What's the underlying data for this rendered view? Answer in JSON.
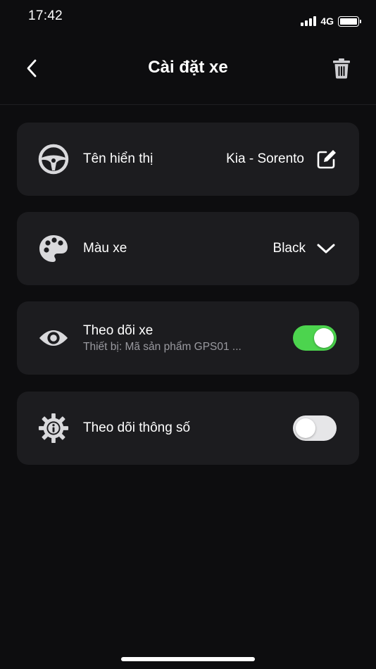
{
  "status_bar": {
    "time": "17:42",
    "network": "4G",
    "icons": [
      "signal-bars-icon",
      "battery-icon"
    ]
  },
  "header": {
    "title": "Cài đặt xe",
    "back_icon": "chevron-left-icon",
    "delete_icon": "trash-icon"
  },
  "settings": {
    "display_name": {
      "icon": "steering-wheel-icon",
      "label": "Tên hiển thị",
      "value": "Kia - Sorento",
      "action_icon": "edit-icon"
    },
    "car_color": {
      "icon": "palette-icon",
      "label": "Màu xe",
      "value": "Black",
      "action_icon": "chevron-down-icon"
    },
    "track_car": {
      "icon": "eye-icon",
      "label": "Theo dõi xe",
      "subtitle": "Thiết bị: Mã sản phẩm GPS01 ...",
      "enabled": true
    },
    "track_params": {
      "icon": "gear-info-icon",
      "label": "Theo dõi thông số",
      "enabled": false
    }
  },
  "colors": {
    "background": "#0d0d0f",
    "card": "#1c1c1f",
    "toggle_on": "#4cd44e",
    "toggle_off": "#e6e6e8"
  }
}
